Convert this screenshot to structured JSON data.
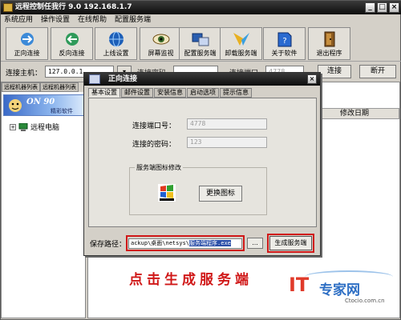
{
  "window": {
    "title": "远程控制任我行 9.0  192.168.1.7"
  },
  "menu": [
    "系统应用",
    "操作设置",
    "在线帮助",
    "配置服务端"
  ],
  "toolbar": [
    {
      "label": "正向连接",
      "icon": "forward-connect-icon"
    },
    {
      "label": "反向连接",
      "icon": "reverse-connect-icon"
    },
    {
      "label": "上线设置",
      "icon": "online-settings-icon"
    },
    {
      "label": "屏幕监视",
      "icon": "screen-monitor-icon"
    },
    {
      "label": "配置服务端",
      "icon": "configure-server-icon"
    },
    {
      "label": "卸载服务端",
      "icon": "uninstall-server-icon"
    },
    {
      "label": "关于软件",
      "icon": "about-icon"
    },
    {
      "label": "退出程序",
      "icon": "exit-icon"
    }
  ],
  "connection": {
    "host_label": "连接主机：",
    "host_value": "127.0.0.1",
    "password_label": "连接密码",
    "port_label": "连接端口",
    "port_value": "4778",
    "connect_button": "连接",
    "disconnect_button": "断开"
  },
  "left_panel": {
    "tabs": [
      "远程机器列表",
      "远程机器列表"
    ],
    "banner_title": "ON 90",
    "banner_sub": "精彩软件",
    "tree_item": "远程电脑"
  },
  "right_panel": {
    "column": "修改日期"
  },
  "dialog": {
    "title": "正向连接",
    "tabs": [
      "基本设置",
      "邮件设置",
      "安装信息",
      "启动选项",
      "提示信息"
    ],
    "active_tab": 0,
    "port_label": "连接端口号：",
    "port_value": "4778",
    "password_label": "连接的密码：",
    "password_value": "123",
    "icon_group_label": "服务端图标修改",
    "change_icon_button": "更换图标",
    "save_path_label": "保存路径：",
    "save_path_prefix": "ackup\\桌面\\netsys\\",
    "save_path_selected": "服务端程序.exe",
    "browse_button": "...",
    "generate_button": "生成服务端"
  },
  "caption": "点击生成服务端",
  "watermark": {
    "mark": "IT",
    "name": "专家网",
    "url": "Ctocio.com.cn"
  },
  "colors": {
    "highlight": "#d01818",
    "titlebar": "#111111",
    "selection": "#2b4fa8"
  }
}
